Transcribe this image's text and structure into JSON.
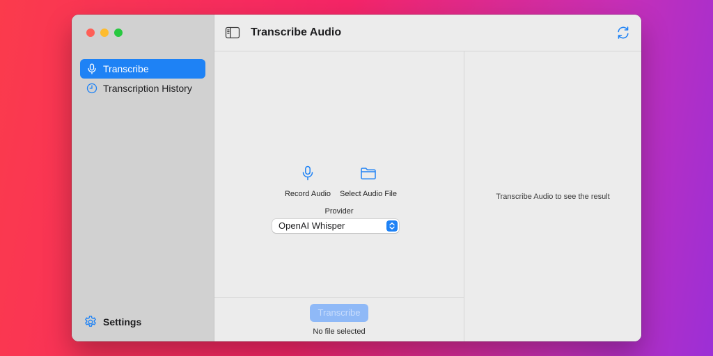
{
  "window": {
    "title": "Transcribe Audio"
  },
  "sidebar": {
    "items": [
      {
        "label": "Transcribe",
        "icon": "microphone-icon",
        "active": true
      },
      {
        "label": "Transcription History",
        "icon": "clock-icon",
        "active": false
      }
    ],
    "settings_label": "Settings",
    "settings_icon": "gear-icon"
  },
  "toolbar": {
    "sidebar_toggle_icon": "sidebar-toggle-icon",
    "refresh_icon": "refresh-icon"
  },
  "main": {
    "record_label": "Record Audio",
    "record_icon": "microphone-icon",
    "select_file_label": "Select Audio File",
    "select_file_icon": "folder-icon",
    "provider_label": "Provider",
    "provider_value": "OpenAI Whisper",
    "transcribe_button_label": "Transcribe",
    "transcribe_button_enabled": false,
    "file_status": "No file selected"
  },
  "result": {
    "placeholder": "Transcribe Audio to see the result"
  },
  "colors": {
    "accent": "#1e82f5",
    "sidebar_bg": "#d1d1d1",
    "content_bg": "#ececec",
    "disabled_button": "#8fb9f7"
  }
}
